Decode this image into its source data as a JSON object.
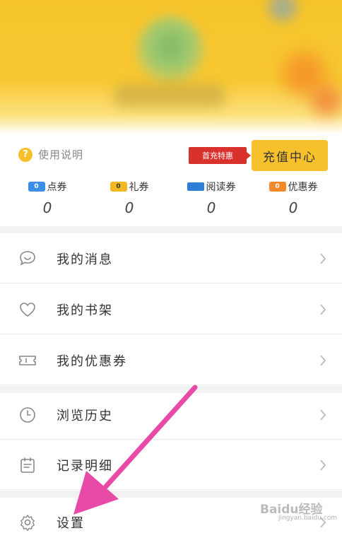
{
  "help": {
    "label": "使用说明",
    "icon": "question-icon"
  },
  "promo": {
    "tag": "首充特惠",
    "button": "充值中心"
  },
  "coupons": [
    {
      "name": "点券",
      "count": "0",
      "color": "#3a8ee6",
      "icon": "point-ticket-icon"
    },
    {
      "name": "礼券",
      "count": "0",
      "color": "#f2b824",
      "icon": "gift-ticket-icon"
    },
    {
      "name": "阅读券",
      "count": "0",
      "color": "#2f7fd8",
      "icon": "read-ticket-icon"
    },
    {
      "name": "优惠券",
      "count": "0",
      "color": "#f08a2a",
      "icon": "discount-ticket-icon"
    }
  ],
  "menu": [
    {
      "label": "我的消息",
      "icon": "message-icon"
    },
    {
      "label": "我的书架",
      "icon": "heart-icon"
    },
    {
      "label": "我的优惠券",
      "icon": "coupon-icon"
    },
    {
      "label": "浏览历史",
      "icon": "clock-icon"
    },
    {
      "label": "记录明细",
      "icon": "calendar-icon"
    },
    {
      "label": "设置",
      "icon": "gear-icon"
    }
  ],
  "watermark": {
    "text": "Baidu经验",
    "sub": "jingyan.baidu.com"
  },
  "colors": {
    "accent": "#f7c12b",
    "promo_red": "#d9312c",
    "arrow": "#e84aa8"
  }
}
